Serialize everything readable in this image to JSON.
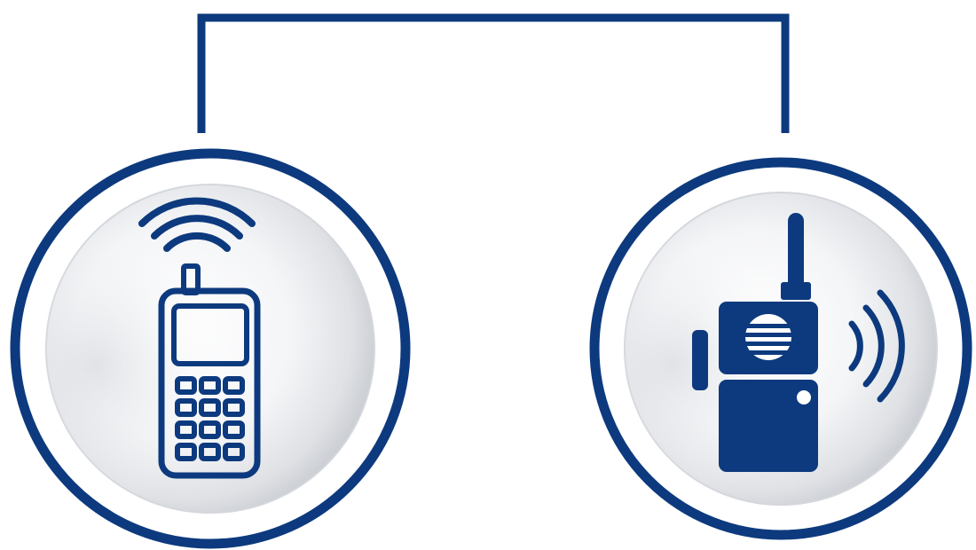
{
  "diagram": {
    "accent_color": "#0d3a7e",
    "background_color": "#ffffff",
    "connector": {
      "from": "mobile-phone-node",
      "to": "two-way-radio-node",
      "style": "elbow-line-over-top"
    },
    "nodes": [
      {
        "id": "mobile-phone-node",
        "icon": "mobile-phone-icon",
        "signal": "signal-arcs-above-antenna"
      },
      {
        "id": "two-way-radio-node",
        "icon": "two-way-radio-icon",
        "signal": "sound-waves-right"
      }
    ]
  }
}
